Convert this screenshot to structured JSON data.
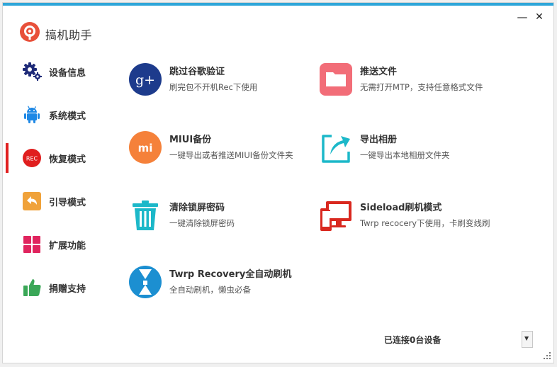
{
  "app": {
    "title": "搞机助手"
  },
  "window": {
    "minimize_glyph": "—",
    "close_glyph": "✕"
  },
  "sidebar": {
    "items": [
      {
        "label": "设备信息",
        "icon": "gear-icon"
      },
      {
        "label": "系统模式",
        "icon": "android-icon"
      },
      {
        "label": "恢复模式",
        "icon": "rec-icon",
        "badge": "REC",
        "active": true
      },
      {
        "label": "引导模式",
        "icon": "back-arrow-icon"
      },
      {
        "label": "扩展功能",
        "icon": "grid-icon"
      },
      {
        "label": "捐赠支持",
        "icon": "thumbs-up-icon"
      }
    ]
  },
  "features": [
    {
      "title": "跳过谷歌验证",
      "desc": "刷完包不开机Rec下使用",
      "icon": "google-plus-icon",
      "glyph": "g+"
    },
    {
      "title": "推送文件",
      "desc": "无需打开MTP，支持任意格式文件",
      "icon": "folder-icon"
    },
    {
      "title": "MIUI备份",
      "desc": "一键导出或者推送MIUI备份文件夹",
      "icon": "mi-icon",
      "glyph": "mi"
    },
    {
      "title": "导出相册",
      "desc": "一键导出本地相册文件夹",
      "icon": "export-icon"
    },
    {
      "title": "清除锁屏密码",
      "desc": "一键清除锁屏密码",
      "icon": "trash-icon"
    },
    {
      "title": "Sideload刷机模式",
      "desc": "Twrp recocery下使用，卡刷变线刷",
      "icon": "devices-icon"
    },
    {
      "title": "Twrp Recovery全自动刷机",
      "desc": "全自动刷机，懒虫必备",
      "icon": "twrp-icon"
    }
  ],
  "status": {
    "text": "已连接0台设备",
    "dropdown_glyph": "▼"
  },
  "colors": {
    "accent": "#2fa6d9",
    "active": "#e02020",
    "google": "#1d3b8c",
    "folder": "#f26d78",
    "mi": "#f5813a",
    "teal": "#1cb8c9",
    "devices": "#d9281f",
    "twrp": "#1c8fd1"
  }
}
